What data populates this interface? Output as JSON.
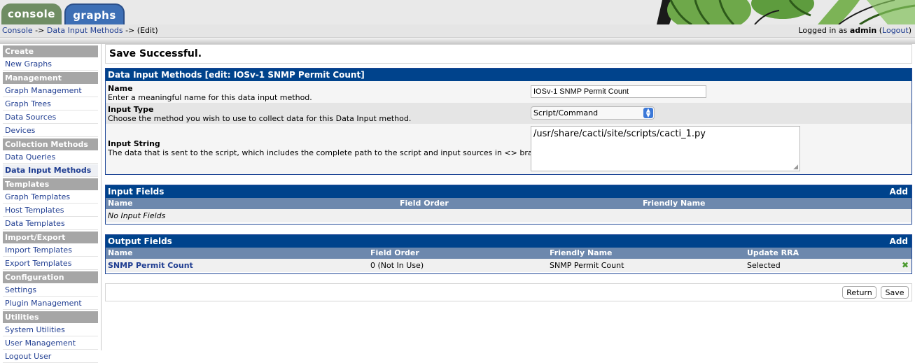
{
  "tabs": {
    "console": "console",
    "graphs": "graphs"
  },
  "breadcrumb": {
    "console": "Console",
    "sep1": " -> ",
    "dim": "Data Input Methods",
    "sep2": " -> (Edit)"
  },
  "login": {
    "prefix": "Logged in as ",
    "user": "admin",
    "open": " (",
    "logout": "Logout",
    "close": ")"
  },
  "sidebar": {
    "create": "Create",
    "new_graphs": "New Graphs",
    "management": "Management",
    "graph_management": "Graph Management",
    "graph_trees": "Graph Trees",
    "data_sources": "Data Sources",
    "devices": "Devices",
    "collection": "Collection Methods",
    "data_queries": "Data Queries",
    "data_input_methods": "Data Input Methods",
    "templates": "Templates",
    "graph_templates": "Graph Templates",
    "host_templates": "Host Templates",
    "data_templates": "Data Templates",
    "import_export": "Import/Export",
    "import_templates": "Import Templates",
    "export_templates": "Export Templates",
    "configuration": "Configuration",
    "settings": "Settings",
    "plugin_management": "Plugin Management",
    "utilities": "Utilities",
    "system_utilities": "System Utilities",
    "user_management": "User Management",
    "logout_user": "Logout User"
  },
  "message": "Save Successful.",
  "edit_panel": {
    "title": "Data Input Methods",
    "subtitle": "[edit: IOSv-1 SNMP Permit Count]",
    "name_label": "Name",
    "name_desc": "Enter a meaningful name for this data input method.",
    "name_value": "IOSv-1 SNMP Permit Count",
    "type_label": "Input Type",
    "type_desc": "Choose the method you wish to use to collect data for this Data Input method.",
    "type_value": "Script/Command",
    "string_label": "Input String",
    "string_desc": "The data that is sent to the script, which includes the complete path to the script and input sources in <> brackets.",
    "string_value": "/usr/share/cacti/site/scripts/cacti_1.py"
  },
  "input_fields": {
    "title": "Input Fields",
    "add": "Add",
    "col_name": "Name",
    "col_order": "Field Order",
    "col_friendly": "Friendly Name",
    "empty": "No Input Fields"
  },
  "output_fields": {
    "title": "Output Fields",
    "add": "Add",
    "col_name": "Name",
    "col_order": "Field Order",
    "col_friendly": "Friendly Name",
    "col_rra": "Update RRA",
    "rows": [
      {
        "name": "SNMP Permit Count",
        "order": "0 (Not In Use)",
        "friendly": "SNMP Permit Count",
        "rra": "Selected"
      }
    ]
  },
  "buttons": {
    "return": "Return",
    "save": "Save"
  },
  "colors": {
    "header_blue": "#00438c",
    "column_blue": "#6d88ad",
    "link_blue": "#1f3d91"
  }
}
